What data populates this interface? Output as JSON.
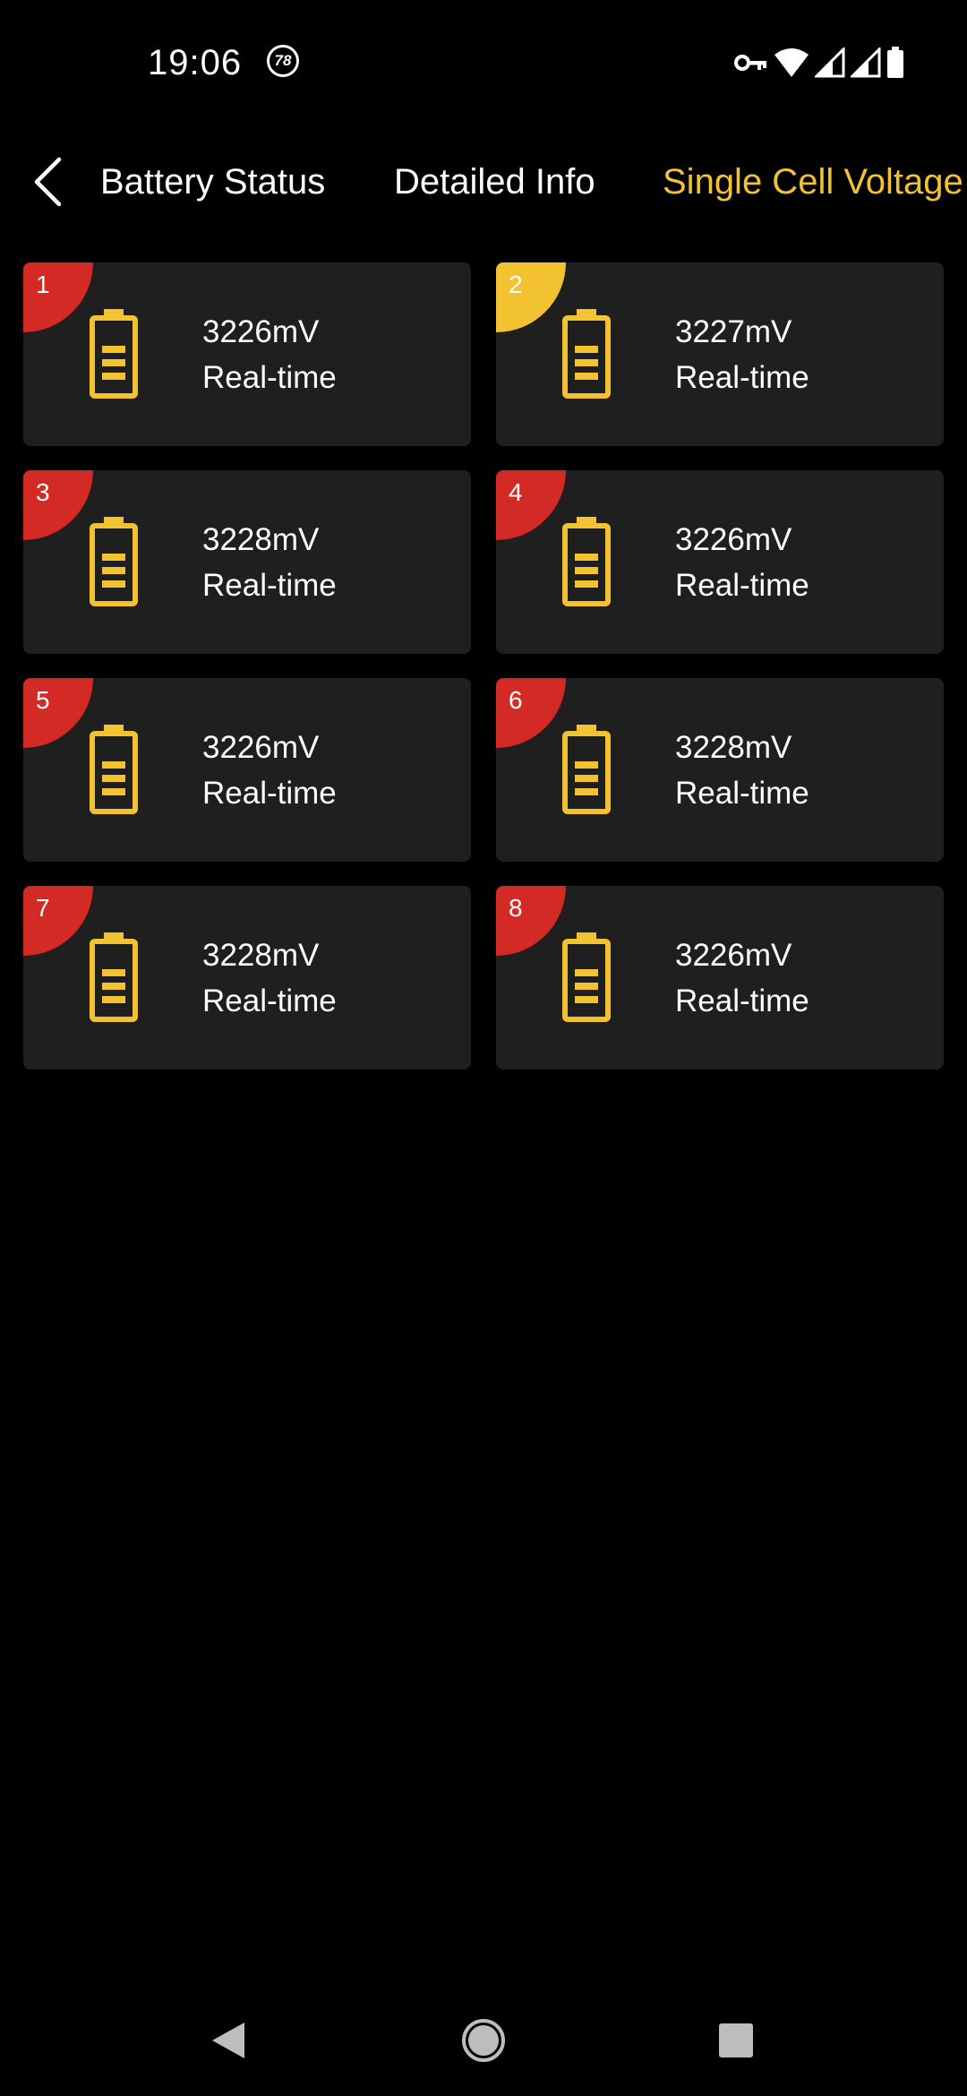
{
  "status_bar": {
    "time": "19:06",
    "notification_badge": "78",
    "icons": [
      "key-icon",
      "wifi-icon",
      "signal-icon",
      "signal-icon",
      "battery-icon"
    ]
  },
  "header": {
    "back_icon": "chevron-left-icon",
    "tabs": [
      {
        "label": "Battery Status",
        "active": false
      },
      {
        "label": "Detailed Info",
        "active": false
      },
      {
        "label": "Single Cell Voltage",
        "active": true
      }
    ]
  },
  "colors": {
    "background": "#000000",
    "card": "#1f1f1f",
    "accent_yellow": "#f2c230",
    "badge_red": "#d32a26",
    "badge_yellow": "#f2c230",
    "text": "#ffffff"
  },
  "cells": [
    {
      "index": "1",
      "voltage": "3226mV",
      "status": "Real-time",
      "badge_color": "#d32a26"
    },
    {
      "index": "2",
      "voltage": "3227mV",
      "status": "Real-time",
      "badge_color": "#f2c230"
    },
    {
      "index": "3",
      "voltage": "3228mV",
      "status": "Real-time",
      "badge_color": "#d32a26"
    },
    {
      "index": "4",
      "voltage": "3226mV",
      "status": "Real-time",
      "badge_color": "#d32a26"
    },
    {
      "index": "5",
      "voltage": "3226mV",
      "status": "Real-time",
      "badge_color": "#d32a26"
    },
    {
      "index": "6",
      "voltage": "3228mV",
      "status": "Real-time",
      "badge_color": "#d32a26"
    },
    {
      "index": "7",
      "voltage": "3228mV",
      "status": "Real-time",
      "badge_color": "#d32a26"
    },
    {
      "index": "8",
      "voltage": "3226mV",
      "status": "Real-time",
      "badge_color": "#d32a26"
    }
  ],
  "nav_bar": {
    "icons": [
      "nav-back-icon",
      "nav-home-icon",
      "nav-recents-icon"
    ]
  }
}
